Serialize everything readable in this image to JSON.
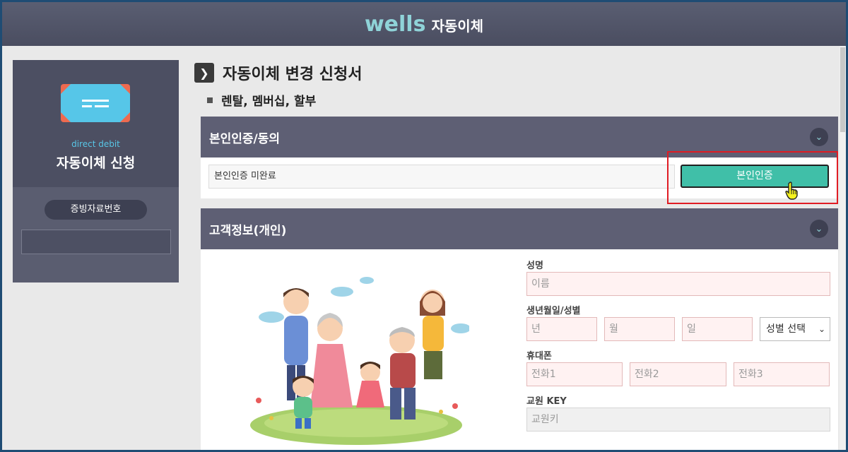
{
  "header": {
    "brand": "wells",
    "title": "자동이체"
  },
  "sidebar": {
    "card_icon": "card-icon",
    "subtitle_en": "direct debit",
    "title": "자동이체 신청",
    "evidence_label": "증빙자료번호",
    "evidence_value": ""
  },
  "page": {
    "title": "자동이체 변경 신청서",
    "subtitle": "렌탈, 멤버십, 할부"
  },
  "auth_section": {
    "title": "본인인증/동의",
    "status_text": "본인인증 미완료",
    "button_label": "본인인증"
  },
  "customer_section": {
    "title": "고객정보(개인)",
    "name_label": "성명",
    "name_placeholder": "이름",
    "birth_label": "생년월일/성별",
    "year_placeholder": "년",
    "month_placeholder": "월",
    "day_placeholder": "일",
    "gender_selected": "성별 선택",
    "phone_label": "휴대폰",
    "phone1_placeholder": "전화1",
    "phone2_placeholder": "전화2",
    "phone3_placeholder": "전화3",
    "key_label": "교원 KEY",
    "key_placeholder": "교원키"
  },
  "colors": {
    "header_bg": "#4f5266",
    "brand": "#8fd3d8",
    "panel_head": "#5e5f74",
    "auth_button": "#40bfa8",
    "highlight": "#e01c24"
  }
}
